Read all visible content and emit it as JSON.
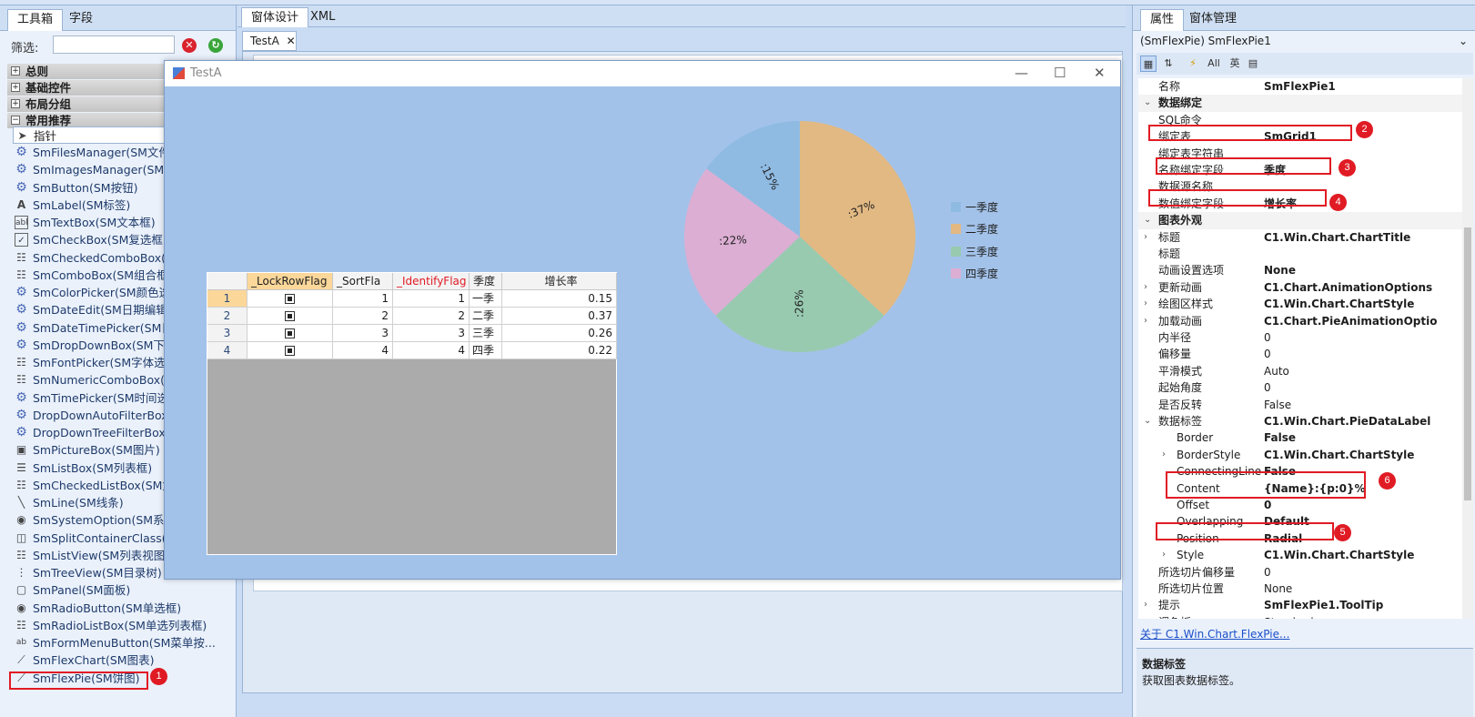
{
  "toolbox": {
    "tabs": [
      "工具箱",
      "字段"
    ],
    "filter_label": "筛选:",
    "groups": [
      "总则",
      "基础控件",
      "布局分组",
      "常用推荐"
    ],
    "items": [
      "指针",
      "SmFilesManager(SM文件管",
      "SmImagesManager(SM图",
      "SmButton(SM按钮)",
      "SmLabel(SM标签)",
      "SmTextBox(SM文本框)",
      "SmCheckBox(SM复选框)",
      "SmCheckedComboBox(SM",
      "SmComboBox(SM组合框)",
      "SmColorPicker(SM颜色选择",
      "SmDateEdit(SM日期编辑框",
      "SmDateTimePicker(SM日期",
      "SmDropDownBox(SM下拉",
      "SmFontPicker(SM字体选择",
      "SmNumericComboBox(SM",
      "SmTimePicker(SM时间选择",
      "DropDownAutoFilterBox(S",
      "DropDownTreeFilterBox(S",
      "SmPictureBox(SM图片)",
      "SmListBox(SM列表框)",
      "SmCheckedListBox(SM复选",
      "SmLine(SM线条)",
      "SmSystemOption(SM系统",
      "SmSplitContainerClass(SM",
      "SmListView(SM列表视图)",
      "SmTreeView(SM目录树)",
      "SmPanel(SM面板)",
      "SmRadioButton(SM单选框)",
      "SmRadioListBox(SM单选列表框)",
      "SmFormMenuButton(SM菜单按...",
      "SmFlexChart(SM图表)",
      "SmFlexPie(SM饼图)"
    ]
  },
  "center": {
    "tabs": [
      "窗体设计",
      "XML"
    ],
    "doc_tab": "TestA"
  },
  "form": {
    "title": "TestA",
    "grid": {
      "columns": [
        "_LockRowFlag",
        "_SortFla",
        "_IdentifyFlag",
        "季度",
        "增长率"
      ],
      "rows": [
        {
          "row": "1",
          "sort": "1",
          "identify": "1",
          "season": "一季",
          "growth": "0.15"
        },
        {
          "row": "2",
          "sort": "2",
          "identify": "2",
          "season": "二季",
          "growth": "0.37"
        },
        {
          "row": "3",
          "sort": "3",
          "identify": "3",
          "season": "三季",
          "growth": "0.26"
        },
        {
          "row": "4",
          "sort": "4",
          "identify": "4",
          "season": "四季",
          "growth": "0.22"
        }
      ]
    }
  },
  "chart_data": {
    "type": "pie",
    "categories": [
      "一季度",
      "二季度",
      "三季度",
      "四季度"
    ],
    "values": [
      0.15,
      0.37,
      0.26,
      0.22
    ],
    "data_labels": [
      ":15%",
      ":37%",
      ":26%",
      ":22%"
    ],
    "colors": [
      "#8fbbe3",
      "#e2b982",
      "#98cab0",
      "#dcaed3"
    ],
    "legend": "right"
  },
  "properties": {
    "tabs": [
      "属性",
      "窗体管理"
    ],
    "object": "(SmFlexPie) SmFlexPie1",
    "toolbar": [
      "All",
      "英"
    ],
    "rows": [
      {
        "name": "名称",
        "value": "SmFlexPie1",
        "bold": true
      },
      {
        "name": "数据绑定",
        "value": "",
        "cat": true
      },
      {
        "name": "SQL命令",
        "value": ""
      },
      {
        "name": "绑定表",
        "value": "SmGrid1",
        "bold": true
      },
      {
        "name": "绑定表字符串",
        "value": ""
      },
      {
        "name": "名称绑定字段",
        "value": "季度",
        "bold": true
      },
      {
        "name": "数据源名称",
        "value": ""
      },
      {
        "name": "数值绑定字段",
        "value": "增长率",
        "bold": true
      },
      {
        "name": "图表外观",
        "value": "",
        "cat": true
      },
      {
        "name": "标题",
        "value": "C1.Win.Chart.ChartTitle",
        "bold": true,
        "exp": true
      },
      {
        "name": "标题",
        "value": ""
      },
      {
        "name": "动画设置选项",
        "value": "None",
        "bold": true
      },
      {
        "name": "更新动画",
        "value": "C1.Chart.AnimationOptions",
        "bold": true,
        "exp": true
      },
      {
        "name": "绘图区样式",
        "value": "C1.Win.Chart.ChartStyle",
        "bold": true,
        "exp": true
      },
      {
        "name": "加载动画",
        "value": "C1.Chart.PieAnimationOptio",
        "bold": true,
        "exp": true
      },
      {
        "name": "内半径",
        "value": "0"
      },
      {
        "name": "偏移量",
        "value": "0"
      },
      {
        "name": "平滑模式",
        "value": "Auto"
      },
      {
        "name": "起始角度",
        "value": "0"
      },
      {
        "name": "是否反转",
        "value": "False"
      },
      {
        "name": "数据标签",
        "value": "C1.Win.Chart.PieDataLabel",
        "bold": true,
        "open": true
      },
      {
        "name": "Border",
        "value": "False",
        "bold": true,
        "sub": true
      },
      {
        "name": "BorderStyle",
        "value": "C1.Win.Chart.ChartStyle",
        "bold": true,
        "sub": true,
        "exp": true
      },
      {
        "name": "ConnectingLine",
        "value": "False",
        "bold": true,
        "sub": true
      },
      {
        "name": "Content",
        "value": "{Name}:{p:0}%",
        "bold": true,
        "sub": true
      },
      {
        "name": "Offset",
        "value": "0",
        "bold": true,
        "sub": true
      },
      {
        "name": "Overlapping",
        "value": "Default",
        "bold": true,
        "sub": true
      },
      {
        "name": "Position",
        "value": "Radial",
        "bold": true,
        "sub": true
      },
      {
        "name": "Style",
        "value": "C1.Win.Chart.ChartStyle",
        "bold": true,
        "sub": true,
        "exp": true
      },
      {
        "name": "所选切片偏移量",
        "value": "0"
      },
      {
        "name": "所选切片位置",
        "value": "None"
      },
      {
        "name": "提示",
        "value": "SmFlexPie1.ToolTip",
        "bold": true,
        "exp": true
      },
      {
        "name": "调色板",
        "value": "Standard"
      }
    ],
    "link": "关于 C1.Win.Chart.FlexPie...",
    "desc_title": "数据标签",
    "desc_text": "获取图表数据标签。"
  },
  "annotations": [
    "1",
    "2",
    "3",
    "4",
    "5",
    "6"
  ]
}
